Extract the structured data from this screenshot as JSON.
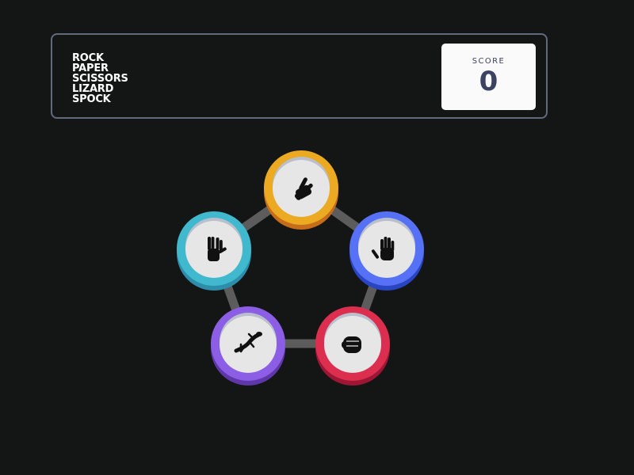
{
  "header": {
    "title_lines": [
      "ROCK",
      "PAPER",
      "SCISSORS",
      "LIZARD",
      "SPOCK"
    ]
  },
  "score": {
    "label": "SCORE",
    "value": "0"
  },
  "choices": [
    {
      "id": "scissors",
      "icon": "scissors-hand-icon",
      "color": "#eca922",
      "shadow": "#c76c1b"
    },
    {
      "id": "paper",
      "icon": "paper-hand-icon",
      "color": "#5671f5",
      "shadow": "#2a45c2"
    },
    {
      "id": "rock",
      "icon": "rock-fist-icon",
      "color": "#dc2e4e",
      "shadow": "#9d1634"
    },
    {
      "id": "lizard",
      "icon": "lizard-icon",
      "color": "#8c5de5",
      "shadow": "#5f37a8"
    },
    {
      "id": "spock",
      "icon": "spock-hand-icon",
      "color": "#40b9ce",
      "shadow": "#2d8dab"
    }
  ],
  "connector_color": "#5c5c5c",
  "face_color": "#e6e6e6"
}
